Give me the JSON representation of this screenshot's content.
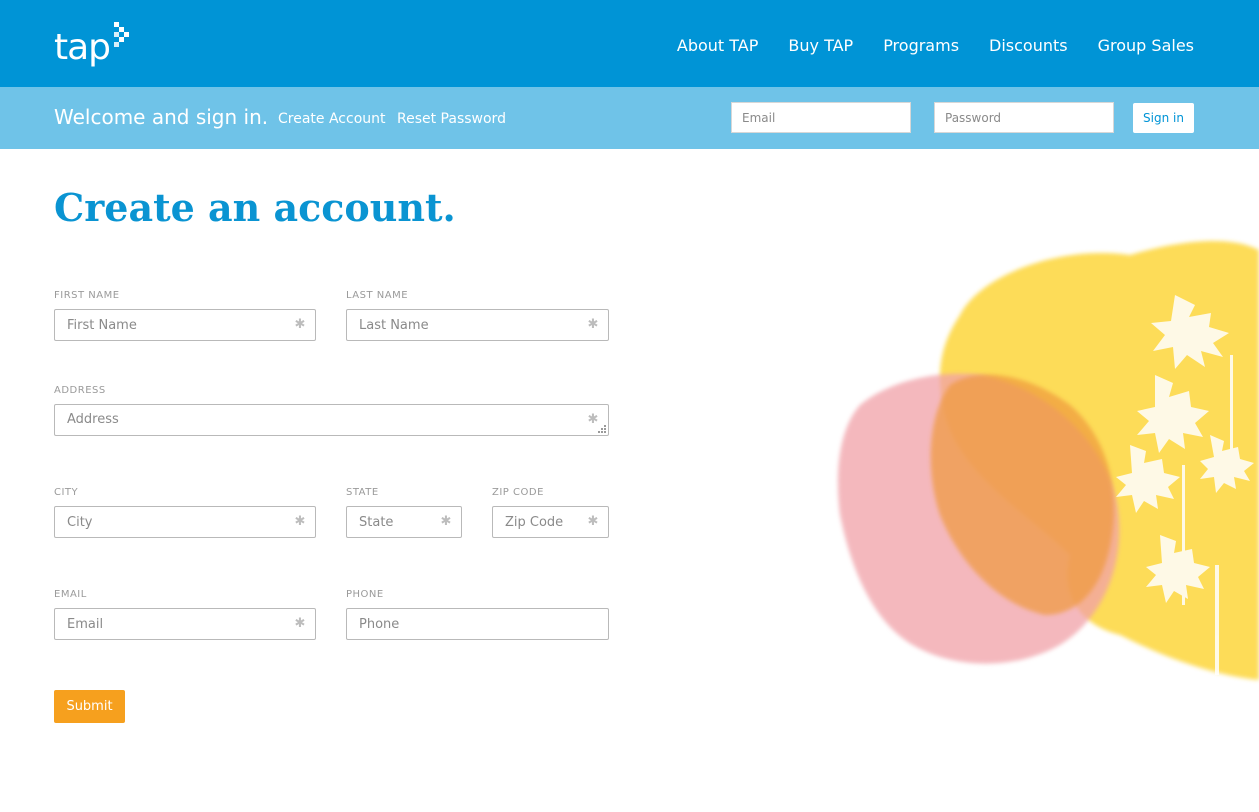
{
  "header": {
    "logo_text": "tap",
    "nav": [
      {
        "label": "About TAP"
      },
      {
        "label": "Buy TAP"
      },
      {
        "label": "Programs"
      },
      {
        "label": "Discounts"
      },
      {
        "label": "Group Sales"
      }
    ],
    "colors": {
      "primary": "#0094d6",
      "subbar": "#6fc3e8",
      "accent": "#f6a01e"
    }
  },
  "signin": {
    "welcome": "Welcome and sign in.",
    "create_account": "Create Account",
    "reset_password": "Reset Password",
    "email_placeholder": "Email",
    "password_placeholder": "Password",
    "sign_in_label": "Sign in"
  },
  "main": {
    "title": "Create an account.",
    "fields": {
      "first_name": {
        "label": "FIRST NAME",
        "placeholder": "First Name",
        "value": ""
      },
      "last_name": {
        "label": "LAST NAME",
        "placeholder": "Last Name",
        "value": ""
      },
      "address": {
        "label": "ADDRESS",
        "placeholder": "Address",
        "value": ""
      },
      "city": {
        "label": "CITY",
        "placeholder": "City",
        "value": ""
      },
      "state": {
        "label": "STATE",
        "placeholder": "State",
        "value": ""
      },
      "zip": {
        "label": "ZIP CODE",
        "placeholder": "Zip Code",
        "value": ""
      },
      "email": {
        "label": "EMAIL",
        "placeholder": "Email",
        "value": ""
      },
      "phone": {
        "label": "PHONE",
        "placeholder": "Phone",
        "value": ""
      }
    },
    "required_icon": "asterisk-icon",
    "submit_label": "Submit"
  }
}
